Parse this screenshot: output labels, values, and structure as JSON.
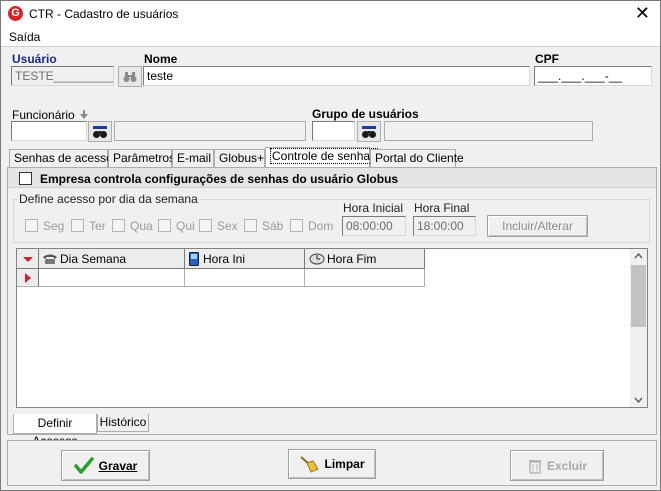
{
  "window": {
    "title": "CTR - Cadastro de usuários",
    "app_icon_letter": "G",
    "close_glyph": "✕"
  },
  "menu": {
    "items": [
      "Saída"
    ]
  },
  "header": {
    "usuario_label": "Usuário",
    "usuario_value": "TESTE__________",
    "nome_label": "Nome",
    "nome_value": "teste",
    "cpf_label": "CPF",
    "cpf_value": "___.___.___-__",
    "funcionario_label": "Funcionário",
    "grupo_label": "Grupo de usuários"
  },
  "tabs": {
    "items": [
      "Senhas de acesso",
      "Parâmetros",
      "E-mail",
      "Globus+",
      "Controle de senhas",
      "Portal do Cliente"
    ],
    "active_index": 4
  },
  "panel": {
    "empresa_checkbox_label": "Empresa controla configurações de senhas do usuário Globus",
    "group_title": "Define acesso por dia da semana",
    "days": [
      "Seg",
      "Ter",
      "Qua",
      "Qui",
      "Sex",
      "Sáb",
      "Dom"
    ],
    "hora_inicial_label": "Hora Inicial",
    "hora_inicial_value": "08:00:00",
    "hora_final_label": "Hora Final",
    "hora_final_value": "18:00:00",
    "incluir_button": "Incluir/Alterar"
  },
  "grid": {
    "columns": [
      "Dia Semana",
      "Hora Ini",
      "Hora Fim"
    ],
    "column_icons": [
      "phone-icon",
      "mobile-icon",
      "clock-icon"
    ]
  },
  "subtabs": {
    "items": [
      "Definir Acessos",
      "Histórico"
    ],
    "active_index": 0
  },
  "footer": {
    "gravar": "Gravar",
    "limpar": "Limpar",
    "excluir": "Excluir"
  },
  "colors": {
    "accent_blue": "#1a2b80",
    "gravar_check": "#2a9d2a",
    "app_icon": "#d3242b",
    "row_indicator": "#c0282d"
  }
}
